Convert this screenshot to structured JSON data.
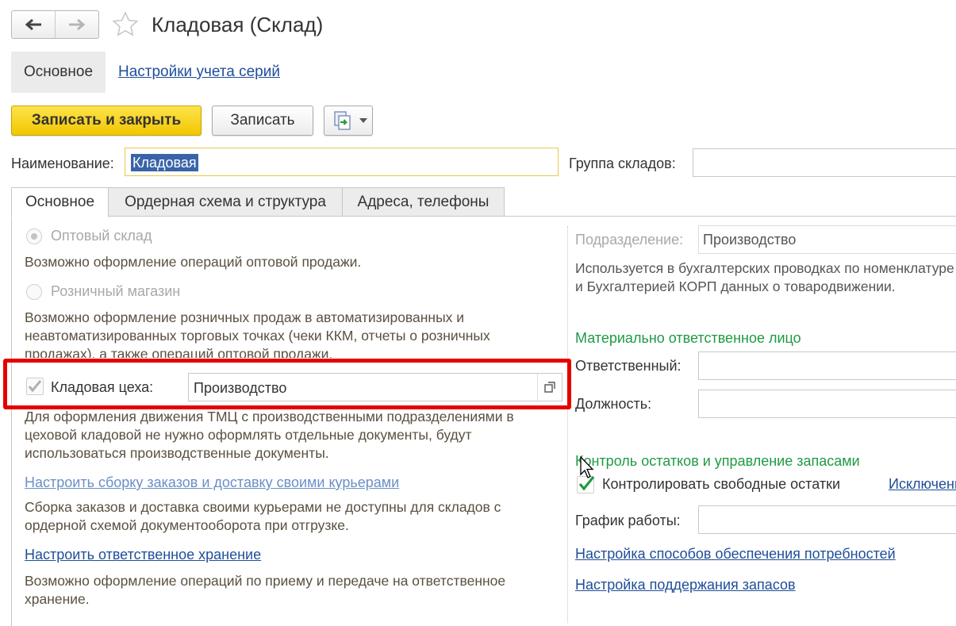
{
  "header": {
    "title": "Кладовая (Склад)"
  },
  "sections": {
    "main_label": "Основное",
    "series_link": "Настройки учета серий"
  },
  "toolbar": {
    "save_close_label": "Записать и закрыть",
    "save_label": "Записать"
  },
  "form": {
    "name_label": "Наименование:",
    "name_value": "Кладовая",
    "group_label": "Группа складов:",
    "group_value": ""
  },
  "tabs": [
    {
      "label": "Основное"
    },
    {
      "label": "Ордерная схема и структура"
    },
    {
      "label": "Адреса, телефоны"
    }
  ],
  "left": {
    "wholesale_label": "Оптовый склад",
    "wholesale_desc": "Возможно оформление операций оптовой продажи.",
    "retail_label": "Розничный магазин",
    "retail_desc": "Возможно оформление розничных продаж в автоматизированных и неавтоматизированных торговых точках (чеки ККМ, отчеты о розничных продажах), а также операций оптовой продажи.",
    "workshop_label": "Кладовая цеха:",
    "workshop_value": "Производство",
    "workshop_desc": "Для оформления движения ТМЦ с производственными подразделениями в цеховой кладовой не нужно оформлять отдельные документы, будут использоваться производственные документы.",
    "assembly_link": "Настроить сборку заказов и доставку своими курьерами",
    "assembly_desc": "Сборка заказов и доставка своими курьерами не доступны для складов с ордерной схемой документооборота при отгрузке.",
    "custody_link": "Настроить ответственное хранение",
    "custody_desc": "Возможно оформление операций по приему и передаче на ответственное хранение."
  },
  "right": {
    "division_label": "Подразделение:",
    "division_value": "Производство",
    "division_desc": "Используется в бухгалтерских проводках по номенклатуре и Бухгалтерией КОРП данных о товародвижении.",
    "mol_header": "Материально ответственное лицо",
    "responsible_label": "Ответственный:",
    "responsible_value": "",
    "position_label": "Должность:",
    "position_value": "",
    "stock_header": "Контроль остатков и управление запасами",
    "control_label": "Контролировать свободные остатки",
    "exceptions_link": "Исключения",
    "schedule_label": "График работы:",
    "schedule_value": "",
    "needs_link": "Настройка способов обеспечения потребностей",
    "stock_link": "Настройка поддержания запасов"
  },
  "colors": {
    "accent_yellow": "#f2c600",
    "link_blue": "#1f4e9a",
    "section_green": "#1f9a43",
    "highlight_red": "#e60000"
  }
}
